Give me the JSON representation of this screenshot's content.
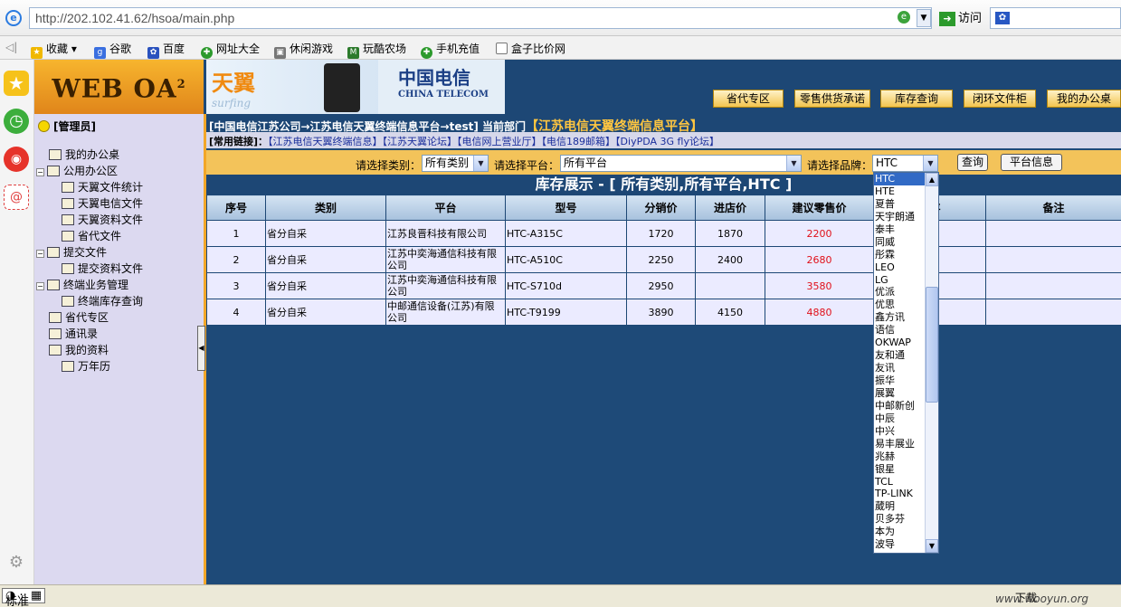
{
  "browser": {
    "url": "http://202.102.41.62/hsoa/main.php",
    "go_label": "访问",
    "favorites": [
      "收藏",
      "谷歌",
      "百度",
      "网址大全",
      "休闲游戏",
      "玩酷农场",
      "手机充值",
      "盒子比价网"
    ]
  },
  "app": {
    "logo_text": "WEB OA",
    "logo_sup": "2",
    "banner": {
      "surfing_cn": "天翼",
      "surfing_en": "surfing",
      "telecom_cn": "中国电信",
      "telecom_en": "CHINA TELECOM"
    },
    "top_nav": [
      "省代专区",
      "零售供货承诺",
      "库存查询",
      "闭环文件柜",
      "我的办公桌"
    ],
    "user_label": "[管理员]",
    "tree": [
      {
        "label": "我的办公桌",
        "level": 1
      },
      {
        "label": "公用办公区",
        "level": 1,
        "expander": "−"
      },
      {
        "label": "天翼文件统计",
        "level": 2
      },
      {
        "label": "天翼电信文件",
        "level": 2
      },
      {
        "label": "天翼资料文件",
        "level": 2
      },
      {
        "label": "省代文件",
        "level": 2
      },
      {
        "label": "提交文件",
        "level": 1,
        "expander": "−"
      },
      {
        "label": "提交资料文件",
        "level": 2
      },
      {
        "label": "终端业务管理",
        "level": 1,
        "expander": "−"
      },
      {
        "label": "终端库存查询",
        "level": 2
      },
      {
        "label": "省代专区",
        "level": 1
      },
      {
        "label": "通讯录",
        "level": 1
      },
      {
        "label": "我的资料",
        "level": 1
      },
      {
        "label": "万年历",
        "level": 2
      }
    ],
    "breadcrumb": "[中国电信江苏公司→江苏电信天翼终端信息平台→test]  当前部门",
    "current_dept": "【江苏电信天翼终端信息平台】",
    "links_label": "[常用链接]：",
    "links": "【江苏电信天翼终端信息】【江苏天翼论坛】【电信网上营业厅】【电信189邮箱】【DiyPDA 3G fly论坛】",
    "filter": {
      "category_label": "请选择类别：",
      "category_value": "所有类别",
      "platform_label": "请选择平台：",
      "platform_value": "所有平台",
      "brand_label": "请选择品牌：",
      "brand_value": "HTC",
      "query_button": "查询",
      "platform_info_button": "平台信息"
    },
    "section_title": "库存展示 - [ 所有类别,所有平台,HTC ]",
    "table": {
      "columns": [
        "序号",
        "类别",
        "平台",
        "型号",
        "分销价",
        "进店价",
        "建议零售价",
        "库存",
        "备注"
      ],
      "visible_columns": [
        "序号",
        "类别",
        "平台",
        "型号",
        "分销价",
        "进店价",
        "建议零售价",
        "库存",
        "备注"
      ],
      "rows": [
        [
          "1",
          "省分自采",
          "江苏良晋科技有限公司",
          "HTC-A315C",
          "1720",
          "1870",
          "2200",
          "",
          ""
        ],
        [
          "2",
          "省分自采",
          "江苏中奕海通信科技有限公司",
          "HTC-A510C",
          "2250",
          "2400",
          "2680",
          "",
          ""
        ],
        [
          "3",
          "省分自采",
          "江苏中奕海通信科技有限公司",
          "HTC-S710d",
          "2950",
          "",
          "3580",
          "",
          ""
        ],
        [
          "4",
          "省分自采",
          "中邮通信设备(江苏)有限公司",
          "HTC-T9199",
          "3890",
          "4150",
          "4880",
          "",
          ""
        ]
      ]
    },
    "brand_dropdown": [
      "HTC",
      "HTE",
      "夏普",
      "天宇朗通",
      "泰丰",
      "同威",
      "彤霖",
      "LEO",
      "LG",
      "优派",
      "优思",
      "鑫方讯",
      "语信",
      "OKWAP",
      "友和通",
      "友讯",
      "振华",
      "展翼",
      "中邮新创",
      "中辰",
      "中兴",
      "易丰展业",
      "兆赫",
      "银星",
      "TCL",
      "TP-LINK",
      "葳明",
      "贝多芬",
      "本为",
      "波导"
    ]
  },
  "statusbar": {
    "ime": "标准",
    "download": "下载",
    "watermark": "www.wooyun.org"
  },
  "colors": {
    "navy": "#1d4775",
    "orange": "#f3c35a",
    "row": "#ebebff",
    "price": "#e0101a"
  }
}
